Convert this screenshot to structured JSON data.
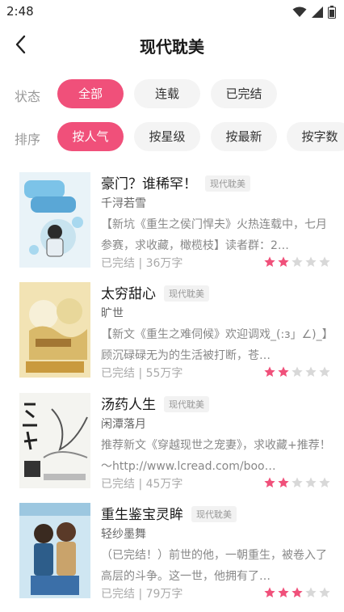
{
  "status": {
    "time": "2:48"
  },
  "nav": {
    "title": "现代耽美"
  },
  "filters": {
    "state_label": "状态",
    "state_options": [
      "全部",
      "连载",
      "已完结"
    ],
    "sort_label": "排序",
    "sort_options": [
      "按人气",
      "按星级",
      "按最新",
      "按字数"
    ]
  },
  "books": [
    {
      "title": "豪门？谁稀罕！",
      "tag": "现代耽美",
      "author": "千浔若雪",
      "desc": "【新坑《重生之侯门悍夫》火热连载中，七月参赛，求收藏，橄榄枝】读者群：2…",
      "meta": "已完结 | 36万字",
      "rating": 2
    },
    {
      "title": "太穷甜心",
      "tag": "现代耽美",
      "author": "旷世",
      "desc": "【新文《重生之难伺候》欢迎调戏_(:з」∠)_】顾沉碌碌无为的生活被打断，苍…",
      "meta": "已完结 | 55万字",
      "rating": 2
    },
    {
      "title": "汤药人生",
      "tag": "现代耽美",
      "author": "闲潭落月",
      "desc": "推荐新文《穿越现世之宠妻》，求收藏+推荐！～http://www.lcread.com/boo…",
      "meta": "已完结 | 45万字",
      "rating": 2
    },
    {
      "title": "重生鉴宝灵眸",
      "tag": "现代耽美",
      "author": "轻纱墨舞",
      "desc": "（已完结！）前世的他，一朝重生，被卷入了高层的斗争。这一世，他拥有了…",
      "meta": "已完结 | 79万字",
      "rating": 3
    }
  ],
  "colors": {
    "accent": "#f0507a",
    "star_empty": "#d8d8d8"
  }
}
